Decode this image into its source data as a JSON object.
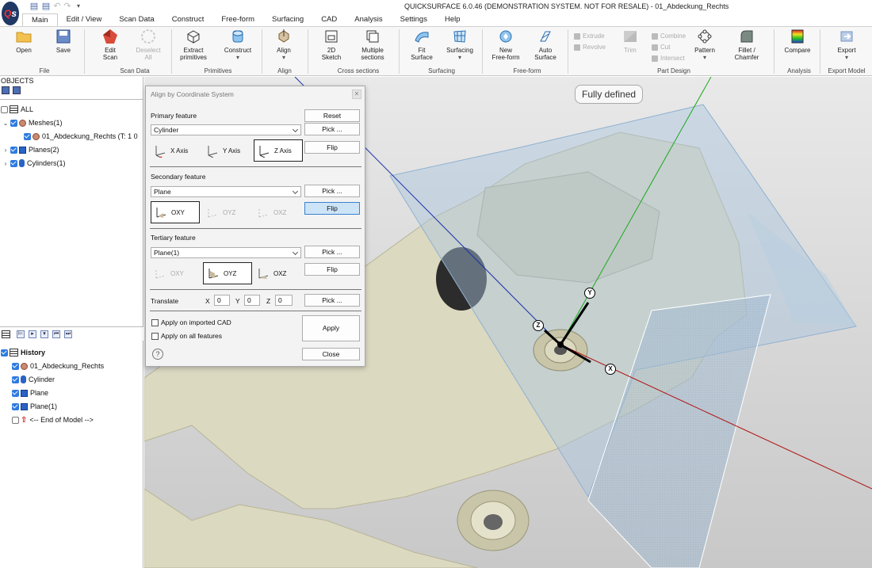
{
  "window": {
    "title": "QUICKSURFACE 6.0.46 (DEMONSTRATION SYSTEM. NOT FOR RESALE) - 01_Abdeckung_Rechts",
    "logo": "Qs"
  },
  "menu": [
    "Main",
    "Edit / View",
    "Scan Data",
    "Construct",
    "Free-form",
    "Surfacing",
    "CAD",
    "Analysis",
    "Settings",
    "Help"
  ],
  "ribbon": {
    "buttons": {
      "open": "Open",
      "save": "Save",
      "edit_scan_1": "Edit",
      "edit_scan_2": "Scan",
      "deselect_1": "Deselect",
      "deselect_2": "All",
      "extract_1": "Extract",
      "extract_2": "primitives",
      "construct": "Construct",
      "align": "Align",
      "sketch_1": "2D",
      "sketch_2": "Sketch",
      "multi_1": "Multiple",
      "multi_2": "sections",
      "fit_1": "Fit",
      "fit_2": "Surface",
      "surfacing": "Surfacing",
      "new_ff_1": "New",
      "new_ff_2": "Free-form",
      "auto_1": "Auto",
      "auto_2": "Surface",
      "extrude": "Extrude",
      "revolve": "Revolve",
      "trim": "Trim",
      "combine": "Combine",
      "cut": "Cut",
      "intersect": "Intersect",
      "pattern": "Pattern",
      "fillet_1": "Fillet /",
      "fillet_2": "Chamfer",
      "compare": "Compare",
      "export": "Export"
    },
    "groups": {
      "file": "File",
      "scan_data": "Scan Data",
      "primitives": "Primitives",
      "align": "Align",
      "cross": "Cross sections",
      "surfacing": "Surfacing",
      "freeform": "Free-form",
      "part_design": "Part Design",
      "analysis": "Analysis",
      "export_model": "Export Model"
    }
  },
  "objects": {
    "header": "OBJECTS",
    "all": "ALL",
    "meshes": "Meshes(1)",
    "mesh_item": "01_Abdeckung_Rechts (T: 1 0",
    "planes": "Planes(2)",
    "cylinders": "Cylinders(1)"
  },
  "history": {
    "header": "History",
    "items": [
      "01_Abdeckung_Rechts",
      "Cylinder",
      "Plane",
      "Plane(1)"
    ],
    "end": "<-- End of Model -->"
  },
  "viewport": {
    "status_badge": "Fully defined",
    "axis_x": "X",
    "axis_y": "Y",
    "axis_z": "Z"
  },
  "dialog": {
    "title": "Align by Coordinate System",
    "primary_label": "Primary feature",
    "primary_value": "Cylinder",
    "secondary_label": "Secondary feature",
    "secondary_value": "Plane",
    "tertiary_label": "Tertiary feature",
    "tertiary_value": "Plane(1)",
    "reset": "Reset",
    "pick": "Pick ...",
    "flip": "Flip",
    "x_axis": "X Axis",
    "y_axis": "Y Axis",
    "z_axis": "Z Axis",
    "oxy": "OXY",
    "oyz": "OYZ",
    "oxz": "OXZ",
    "translate_label": "Translate",
    "tx_label": "X",
    "ty_label": "Y",
    "tz_label": "Z",
    "tx": "0",
    "ty": "0",
    "tz": "0",
    "apply_imported": "Apply on imported CAD",
    "apply_all": "Apply on all features",
    "apply": "Apply",
    "close": "Close",
    "help": "?"
  }
}
